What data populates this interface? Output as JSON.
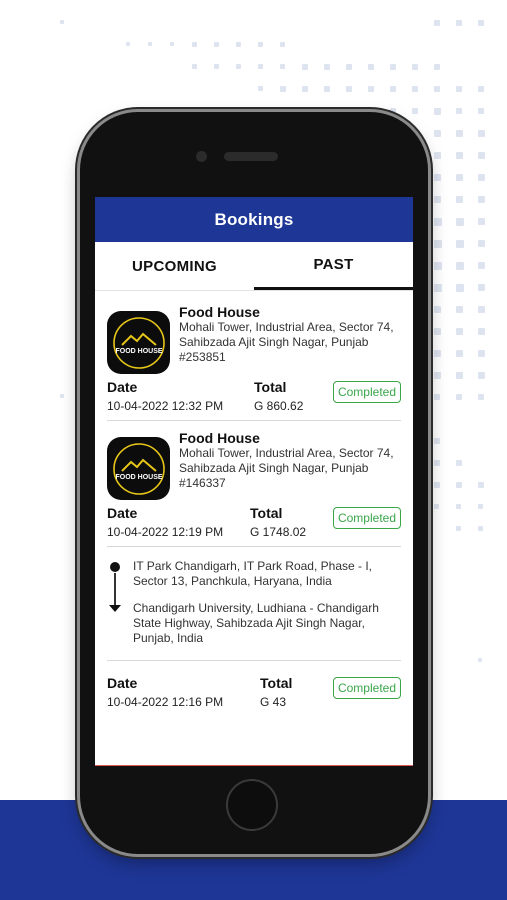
{
  "app": {
    "title": "Bookings"
  },
  "tabs": [
    {
      "label": "UPCOMING",
      "active": false
    },
    {
      "label": "PAST",
      "active": true
    }
  ],
  "bookings": [
    {
      "logo_text": "FOOD HOUSE",
      "name": "Food House",
      "address": "Mohali Tower, Industrial Area, Sector 74, Sahibzada Ajit Singh Nagar, Punjab",
      "order_id": "#253851",
      "date_label": "Date",
      "date": "10-04-2022 12:32 PM",
      "total_label": "Total",
      "total": "G 860.62",
      "status": "Completed"
    },
    {
      "logo_text": "FOOD HOUSE",
      "name": "Food House",
      "address": "Mohali Tower, Industrial Area, Sector 74, Sahibzada Ajit Singh Nagar, Punjab",
      "order_id": "#146337",
      "date_label": "Date",
      "date": "10-04-2022 12:19 PM",
      "total_label": "Total",
      "total": "G 1748.02",
      "status": "Completed"
    }
  ],
  "ride": {
    "pickup": "IT Park Chandigarh, IT Park Road, Phase - I, Sector 13, Panchkula, Haryana, India",
    "drop": "Chandigarh University, Ludhiana - Chandigarh State Highway, Sahibzada Ajit Singh Nagar, Punjab, India",
    "date_label": "Date",
    "date": "10-04-2022 12:16 PM",
    "total_label": "Total",
    "total": "G 43",
    "status": "Completed"
  },
  "colors": {
    "brand": "#1e3696",
    "status_green": "#3aa64a"
  }
}
